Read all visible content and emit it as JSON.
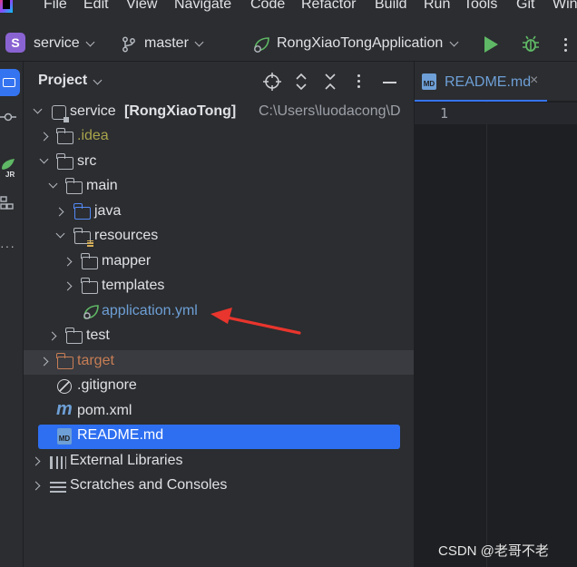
{
  "menubar": {
    "items": [
      "File",
      "Edit",
      "View",
      "Navigate",
      "Code",
      "Refactor",
      "Build",
      "Run",
      "Tools",
      "Git",
      "Win"
    ]
  },
  "toolbar": {
    "project_badge": "S",
    "project_name": "service",
    "branch_name": "master",
    "run_config": "RongXiaoTongApplication",
    "run_icon": "play-icon",
    "debug_icon": "bug-icon",
    "accent": "#3574f0",
    "run_color": "#5fb865"
  },
  "left_strip": {
    "icons": [
      "project-folder-icon",
      "commit-icon",
      "jr-plugin-icon",
      "structure-icon",
      "more-icon"
    ]
  },
  "project_panel": {
    "title": "Project",
    "header_icons": [
      "locate-icon",
      "expand-collapse-icon",
      "close-all-icon",
      "options-icon",
      "minimize-icon"
    ],
    "tree": [
      {
        "id": "root",
        "name": "service",
        "suffix": "[RongXiaoTong]",
        "path": "C:\\Users\\luodacong\\D",
        "expanded": true,
        "icon": "module-icon"
      },
      {
        "id": "idea",
        "name": ".idea",
        "expanded": false,
        "icon": "folder-icon"
      },
      {
        "id": "src",
        "name": "src",
        "expanded": true,
        "icon": "folder-icon"
      },
      {
        "id": "main",
        "name": "main",
        "expanded": true,
        "icon": "folder-icon"
      },
      {
        "id": "java",
        "name": "java",
        "expanded": false,
        "icon": "source-folder-icon"
      },
      {
        "id": "resources",
        "name": "resources",
        "expanded": true,
        "icon": "resources-folder-icon"
      },
      {
        "id": "mapper",
        "name": "mapper",
        "expanded": false,
        "icon": "folder-icon"
      },
      {
        "id": "templates",
        "name": "templates",
        "expanded": false,
        "icon": "folder-icon"
      },
      {
        "id": "application",
        "name": "application.yml",
        "icon": "spring-config-icon"
      },
      {
        "id": "test",
        "name": "test",
        "expanded": false,
        "icon": "folder-icon"
      },
      {
        "id": "target",
        "name": "target",
        "expanded": false,
        "icon": "excluded-folder-icon"
      },
      {
        "id": "gitignore",
        "name": ".gitignore",
        "icon": "gitignore-icon"
      },
      {
        "id": "pom",
        "name": "pom.xml",
        "icon": "maven-icon"
      },
      {
        "id": "readme",
        "name": "README.md",
        "icon": "markdown-icon",
        "selected": true
      },
      {
        "id": "extlib",
        "name": "External Libraries",
        "expanded": false,
        "icon": "library-icon"
      },
      {
        "id": "scratches",
        "name": "Scratches and Consoles",
        "expanded": false,
        "icon": "scratches-icon"
      }
    ]
  },
  "editor": {
    "tab_label": "README.md",
    "tab_icon": "markdown-icon",
    "tab_close": "×",
    "line_numbers": [
      "1"
    ]
  },
  "annotation": {
    "color": "#e8352d",
    "points_to": "application.yml"
  },
  "watermark": "CSDN @老哥不老"
}
